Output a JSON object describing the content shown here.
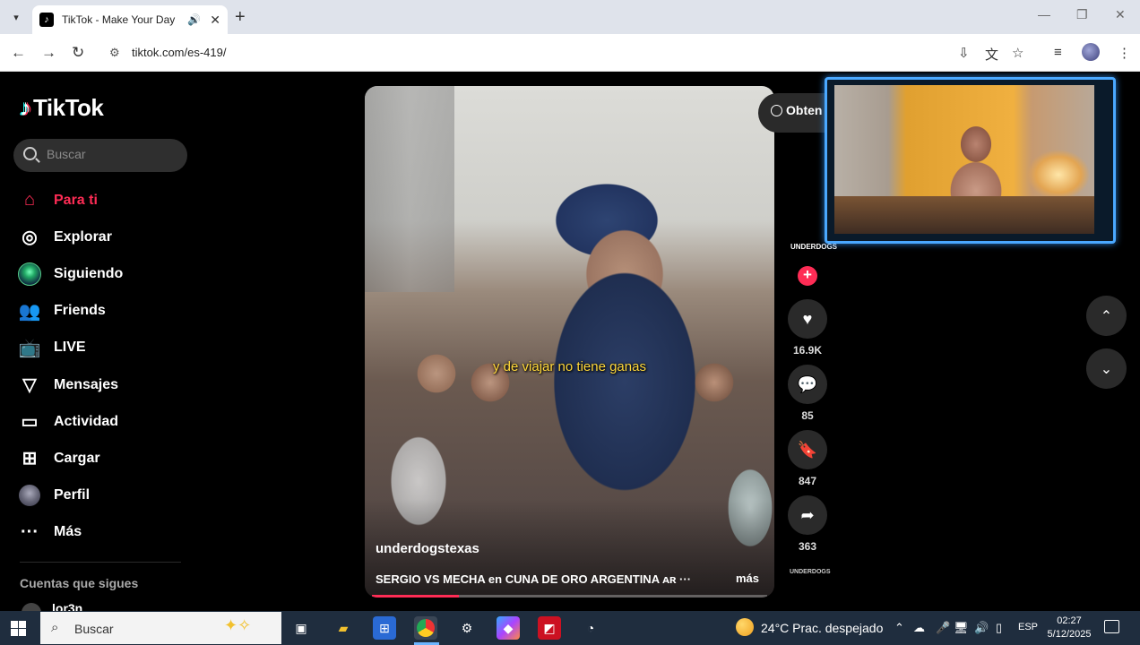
{
  "browser": {
    "tab_title": "TikTok - Make Your Day",
    "url": "tiktok.com/es-419/"
  },
  "sidebar": {
    "logo": "TikTok",
    "search_placeholder": "Buscar",
    "items": [
      {
        "label": "Para ti",
        "icon": "home-icon",
        "active": true
      },
      {
        "label": "Explorar",
        "icon": "compass-icon"
      },
      {
        "label": "Siguiendo",
        "icon": "following-avatar-icon"
      },
      {
        "label": "Friends",
        "icon": "friends-icon"
      },
      {
        "label": "LIVE",
        "icon": "live-icon"
      },
      {
        "label": "Mensajes",
        "icon": "send-icon"
      },
      {
        "label": "Actividad",
        "icon": "activity-icon"
      },
      {
        "label": "Cargar",
        "icon": "upload-icon"
      },
      {
        "label": "Perfil",
        "icon": "profile-avatar-icon"
      },
      {
        "label": "Más",
        "icon": "more-icon"
      }
    ],
    "following_title": "Cuentas que sigues",
    "following_first": "lor3n"
  },
  "video": {
    "caption": "y de viajar no tiene ganas",
    "author": "underdogstexas",
    "description": "SERGIO VS MECHA en CUNA DE ORO ARGENTINA ᴀʀ ···",
    "more": "más",
    "progress": 0.22,
    "get_app": "Obten"
  },
  "actions": {
    "avatar_label": "UNDERDOGS",
    "likes": "16.9K",
    "comments": "85",
    "saves": "847",
    "shares": "363",
    "music_label": "UNDERDOGS"
  },
  "taskbar": {
    "search_text": "Buscar",
    "weather": "24°C  Prac. despejado",
    "language": "ESP",
    "time": "02:27",
    "date": "5/12/2025"
  },
  "colors": {
    "accent": "#fe2c55",
    "taskbar": "#1f2d3e",
    "webcam_border": "#4aa8ff"
  }
}
